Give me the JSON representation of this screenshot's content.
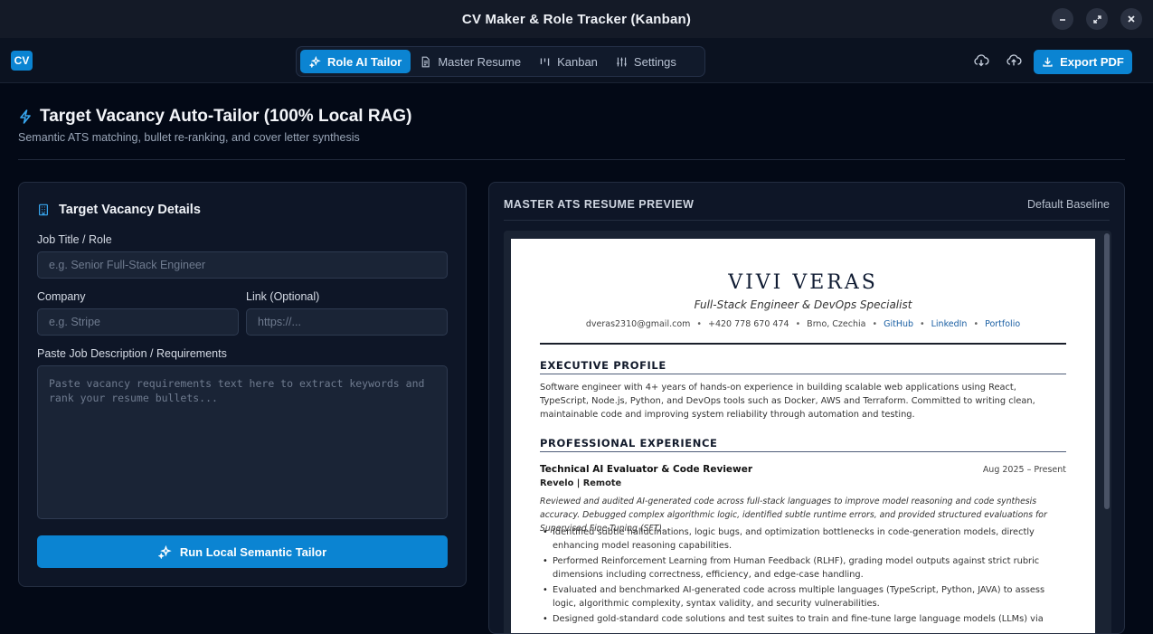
{
  "window": {
    "title": "CV Maker & Role Tracker (Kanban)",
    "controls": [
      "minimize-icon",
      "maximize-icon",
      "close-icon"
    ]
  },
  "toolbar": {
    "logo": "CV",
    "tabs": [
      {
        "label": "Role AI Tailor",
        "icon": "sparkles-icon",
        "active": true
      },
      {
        "label": "Master Resume",
        "icon": "document-icon",
        "active": false
      },
      {
        "label": "Kanban",
        "icon": "kanban-icon",
        "active": false
      },
      {
        "label": "Settings",
        "icon": "sliders-icon",
        "active": false
      }
    ],
    "export_label": "Export PDF"
  },
  "page": {
    "title": "Target Vacancy Auto-Tailor (100% Local RAG)",
    "subtitle": "Semantic ATS matching, bullet re-ranking, and cover letter synthesis"
  },
  "form": {
    "title": "Target Vacancy Details",
    "job_title_label": "Job Title / Role",
    "job_title_placeholder": "e.g. Senior Full-Stack Engineer",
    "company_label": "Company",
    "company_placeholder": "e.g. Stripe",
    "link_label": "Link (Optional)",
    "link_placeholder": "https://...",
    "description_label": "Paste Job Description / Requirements",
    "description_placeholder": "Paste vacancy requirements text here to extract keywords and rank your resume bullets...",
    "run_label": "Run Local Semantic Tailor"
  },
  "preview": {
    "title": "MASTER ATS RESUME PREVIEW",
    "badge": "Default Baseline",
    "resume": {
      "name": "VIVI VERAS",
      "role": "Full-Stack Engineer & DevOps Specialist",
      "contact": {
        "email": "dveras2310@gmail.com",
        "phone": "+420 778 670 474",
        "location": "Brno, Czechia",
        "links": [
          "GitHub",
          "LinkedIn",
          "Portfolio"
        ]
      },
      "profile_heading": "EXECUTIVE PROFILE",
      "profile_text": "Software engineer with 4+ years of hands-on experience in building scalable web applications using React, TypeScript, Node.js, Python, and DevOps tools such as Docker, AWS and Terraform. Committed to writing clean, maintainable code and improving system reliability through automation and testing.",
      "experience_heading": "PROFESSIONAL EXPERIENCE",
      "job": {
        "title": "Technical AI Evaluator & Code Reviewer",
        "dates": "Aug 2025 – Present",
        "company": "Revelo | Remote",
        "summary": "Reviewed and audited AI-generated code across full-stack languages to improve model reasoning and code synthesis accuracy. Debugged complex algorithmic logic, identified subtle runtime errors, and provided structured evaluations for Supervised Fine-Tuning (SFT).",
        "bullets": [
          "Identified subtle hallucinations, logic bugs, and optimization bottlenecks in code-generation models, directly enhancing model reasoning capabilities.",
          "Performed Reinforcement Learning from Human Feedback (RLHF), grading model outputs against strict rubric dimensions including correctness, efficiency, and edge-case handling.",
          "Evaluated and benchmarked AI-generated code across multiple languages (TypeScript, Python, JAVA) to assess logic, algorithmic complexity, syntax validity, and security vulnerabilities.",
          "Designed gold-standard code solutions and test suites to train and fine-tune large language models (LLMs) via"
        ]
      }
    }
  },
  "colors": {
    "accent": "#0b84d2",
    "background": "#030916",
    "panel": "#0e1627"
  }
}
